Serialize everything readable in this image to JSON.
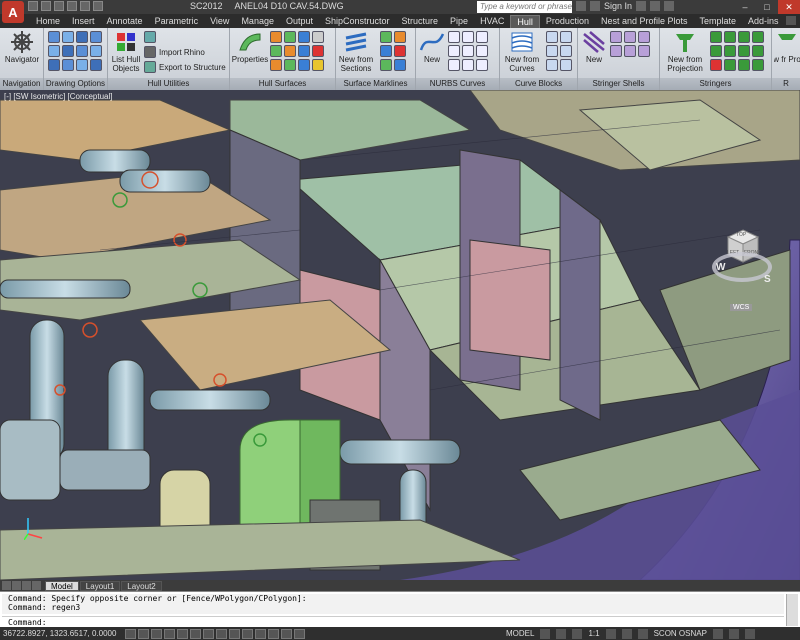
{
  "titlebar": {
    "app_letter": "A",
    "product": "SC2012",
    "document": "ANEL04 D10 CAV.54.DWG",
    "search_placeholder": "Type a keyword or phrase",
    "sign_in": "Sign In"
  },
  "tabs": [
    "Home",
    "Insert",
    "Annotate",
    "Parametric",
    "View",
    "Manage",
    "Output",
    "ShipConstructor",
    "Structure",
    "Pipe",
    "HVAC",
    "Hull",
    "Production",
    "Nest and Profile Plots",
    "Template",
    "Add-ins"
  ],
  "active_tab": "Hull",
  "ribbon": {
    "panels": [
      {
        "title": "Navigation",
        "buttons": [
          "Navigator"
        ]
      },
      {
        "title": "Drawing Options"
      },
      {
        "title": "Hull Utilities",
        "buttons": [
          "List Hull Objects",
          "Import Rhino",
          "Export to Structure"
        ]
      },
      {
        "title": "Hull Surfaces",
        "buttons": [
          "Properties"
        ]
      },
      {
        "title": "Surface Marklines",
        "buttons": [
          "New from Sections"
        ]
      },
      {
        "title": "NURBS Curves",
        "buttons": [
          "New"
        ]
      },
      {
        "title": "Curve Blocks",
        "buttons": [
          "New from Curves"
        ]
      },
      {
        "title": "Stringer Shells",
        "buttons": [
          "New"
        ]
      },
      {
        "title": "Stringers",
        "buttons": [
          "New from Projection"
        ]
      },
      {
        "title": "R",
        "buttons": [
          "New fr Projec"
        ]
      }
    ]
  },
  "viewport": {
    "label": "[-] [SW Isometric] [Conceptual]",
    "viewcube": {
      "top": "TOP",
      "left": "LEFT",
      "front": "FRONT",
      "west": "W",
      "south": "S",
      "wcs": "WCS"
    }
  },
  "layout_tabs": [
    "Model",
    "Layout1",
    "Layout2"
  ],
  "active_layout": "Model",
  "command": {
    "history": [
      "Command: Specify opposite corner or [Fence/WPolygon/CPolygon]:",
      "Command: regen3"
    ],
    "prompt": "Command:"
  },
  "statusbar": {
    "coords": "36722.8927, 1323.6517, 0.0000",
    "model": "MODEL",
    "scale": "1:1",
    "snap": "SCON OSNAP"
  },
  "colors": {
    "ribbon_bg": "#d4d8de",
    "title_bg": "#3b3b3b",
    "close_red": "#c0392b"
  }
}
